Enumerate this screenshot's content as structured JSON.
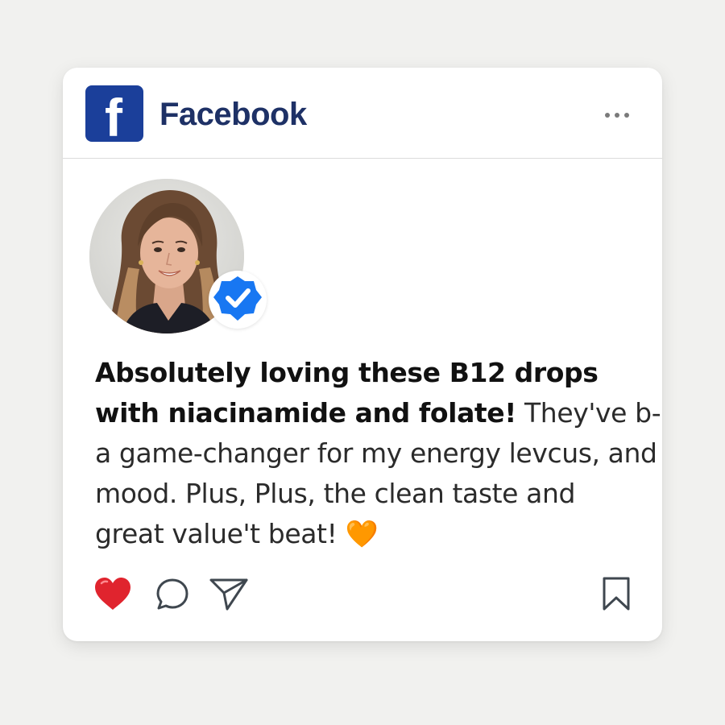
{
  "header": {
    "logo_letter": "f",
    "app_name": "Facebook",
    "more_icon": "more-horizontal-icon"
  },
  "author": {
    "verified_icon": "verified-check-icon"
  },
  "post": {
    "lines": [
      {
        "bold": "Absolutely loving these B12 drops",
        "normal": ""
      },
      {
        "bold": "with niacinamide and folate!",
        "normal": " They've b-"
      },
      {
        "bold": "",
        "normal": "a game-changer for my energy levcus, and"
      },
      {
        "bold": "",
        "normal": "mood. Plus, Plus, the clean taste and"
      },
      {
        "bold": "",
        "normal": "great value't beat! "
      }
    ],
    "emoji": "🧡"
  },
  "actions": {
    "like_icon": "heart-icon",
    "comment_icon": "comment-icon",
    "share_icon": "send-icon",
    "save_icon": "bookmark-icon",
    "like_color": "#e0242e"
  },
  "colors": {
    "brand_blue": "#1b3f9a",
    "brand_text": "#1e3166",
    "verified_blue": "#1877f2"
  }
}
